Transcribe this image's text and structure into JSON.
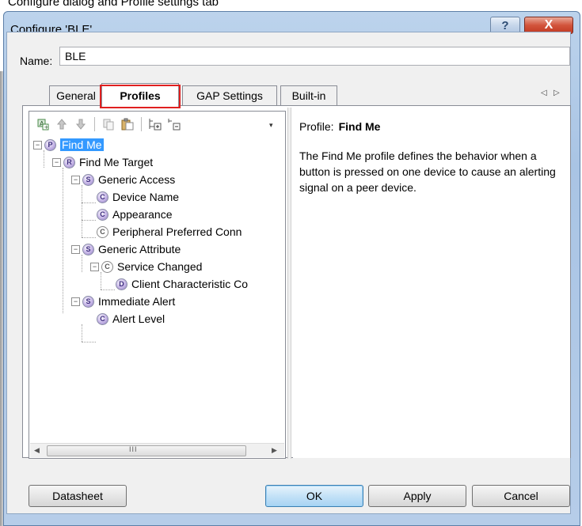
{
  "caption": "Configure dialog and Profile settings tab",
  "window": {
    "title": "Configure 'BLE'",
    "help_glyph": "?",
    "close_glyph": "X"
  },
  "name_field": {
    "label": "Name:",
    "value": "BLE"
  },
  "tabs": [
    {
      "label": "General",
      "active": false
    },
    {
      "label": "Profiles",
      "active": true,
      "highlighted": true
    },
    {
      "label": "GAP Settings",
      "active": false
    },
    {
      "label": "Built-in",
      "active": false
    }
  ],
  "tab_scroll": {
    "left": "◁",
    "right": "▷"
  },
  "toolbar": {
    "icons": [
      "add-service-icon",
      "move-up-icon",
      "move-down-icon",
      "copy-icon",
      "paste-icon",
      "expand-all-icon",
      "collapse-all-icon"
    ],
    "overflow": "▾"
  },
  "tree": [
    {
      "label": "Find Me",
      "icon": "P",
      "level": 0,
      "selected": true,
      "expander": "−"
    },
    {
      "label": "Find Me Target",
      "icon": "R",
      "level": 1,
      "expander": "−"
    },
    {
      "label": "Generic Access",
      "icon": "S",
      "level": 2,
      "expander": "−"
    },
    {
      "label": "Device Name",
      "icon": "C",
      "level": 3
    },
    {
      "label": "Appearance",
      "icon": "C",
      "level": 3
    },
    {
      "label": "Peripheral Preferred Conn",
      "icon": "C",
      "level": 3,
      "plain": true
    },
    {
      "label": "Generic Attribute",
      "icon": "S",
      "level": 2,
      "expander": "−"
    },
    {
      "label": "Service Changed",
      "icon": "C",
      "level": 3,
      "expander": "−",
      "plain": true
    },
    {
      "label": "Client Characteristic Co",
      "icon": "D",
      "level": 4
    },
    {
      "label": "Immediate Alert",
      "icon": "S",
      "level": 2,
      "expander": "−"
    },
    {
      "label": "Alert Level",
      "icon": "C",
      "level": 3
    }
  ],
  "hscroll": {
    "left": "◀",
    "right": "▶",
    "grip": "III"
  },
  "details": {
    "profile_label": "Profile:",
    "profile_name": "Find Me",
    "description": "The Find Me profile defines the behavior when a button is pressed on one device to cause an alerting signal on a peer device."
  },
  "buttons": {
    "datasheet": "Datasheet",
    "ok": "OK",
    "apply": "Apply",
    "cancel": "Cancel"
  }
}
